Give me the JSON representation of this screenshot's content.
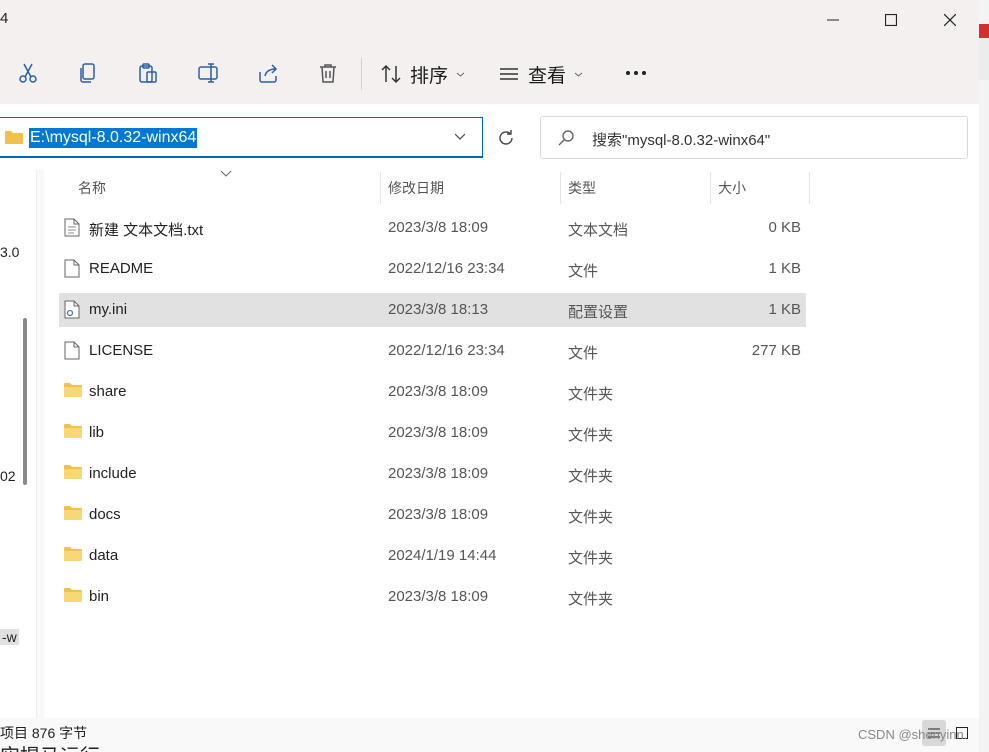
{
  "window": {
    "title_fragment": "4",
    "buttons": {
      "minimize": "minimize",
      "maximize": "maximize",
      "close": "close"
    }
  },
  "toolbar": {
    "cut_icon": "scissors-icon",
    "copy_icon": "copy-icon",
    "paste_icon": "paste-icon",
    "rename_icon": "rename-icon",
    "share_icon": "share-icon",
    "delete_icon": "trash-icon",
    "sort_label": "排序",
    "view_label": "查看",
    "more_icon": "more-icon"
  },
  "address": {
    "path": "E:\\mysql-8.0.32-winx64"
  },
  "search": {
    "placeholder": "搜索\"mysql-8.0.32-winx64\""
  },
  "columns": {
    "name": "名称",
    "modified": "修改日期",
    "type": "类型",
    "size": "大小"
  },
  "files": [
    {
      "name": "新建 文本文档.txt",
      "modified": "2023/3/8 18:09",
      "type": "文本文档",
      "size": "0 KB",
      "icon": "text-file-icon"
    },
    {
      "name": "README",
      "modified": "2022/12/16 23:34",
      "type": "文件",
      "size": "1 KB",
      "icon": "file-icon"
    },
    {
      "name": "my.ini",
      "modified": "2023/3/8 18:13",
      "type": "配置设置",
      "size": "1 KB",
      "icon": "config-file-icon"
    },
    {
      "name": "LICENSE",
      "modified": "2022/12/16 23:34",
      "type": "文件",
      "size": "277 KB",
      "icon": "file-icon"
    },
    {
      "name": "share",
      "modified": "2023/3/8 18:09",
      "type": "文件夹",
      "size": "",
      "icon": "folder-icon"
    },
    {
      "name": "lib",
      "modified": "2023/3/8 18:09",
      "type": "文件夹",
      "size": "",
      "icon": "folder-icon"
    },
    {
      "name": "include",
      "modified": "2023/3/8 18:09",
      "type": "文件夹",
      "size": "",
      "icon": "folder-icon"
    },
    {
      "name": "docs",
      "modified": "2023/3/8 18:09",
      "type": "文件夹",
      "size": "",
      "icon": "folder-icon"
    },
    {
      "name": "data",
      "modified": "2024/1/19 14:44",
      "type": "文件夹",
      "size": "",
      "icon": "folder-icon"
    },
    {
      "name": "bin",
      "modified": "2023/3/8 18:09",
      "type": "文件夹",
      "size": "",
      "icon": "folder-icon"
    }
  ],
  "nav_fragments": {
    "a": "3.0",
    "b": "02",
    "c": "-w"
  },
  "status": {
    "text": "项目 876 字节"
  },
  "watermark": "CSDN @shenyinn.",
  "bottom_fragment": "实提马运行",
  "colors": {
    "selection": "#0078d4",
    "selected_row": "#e1e1e1",
    "folder": "#f4c04d"
  }
}
